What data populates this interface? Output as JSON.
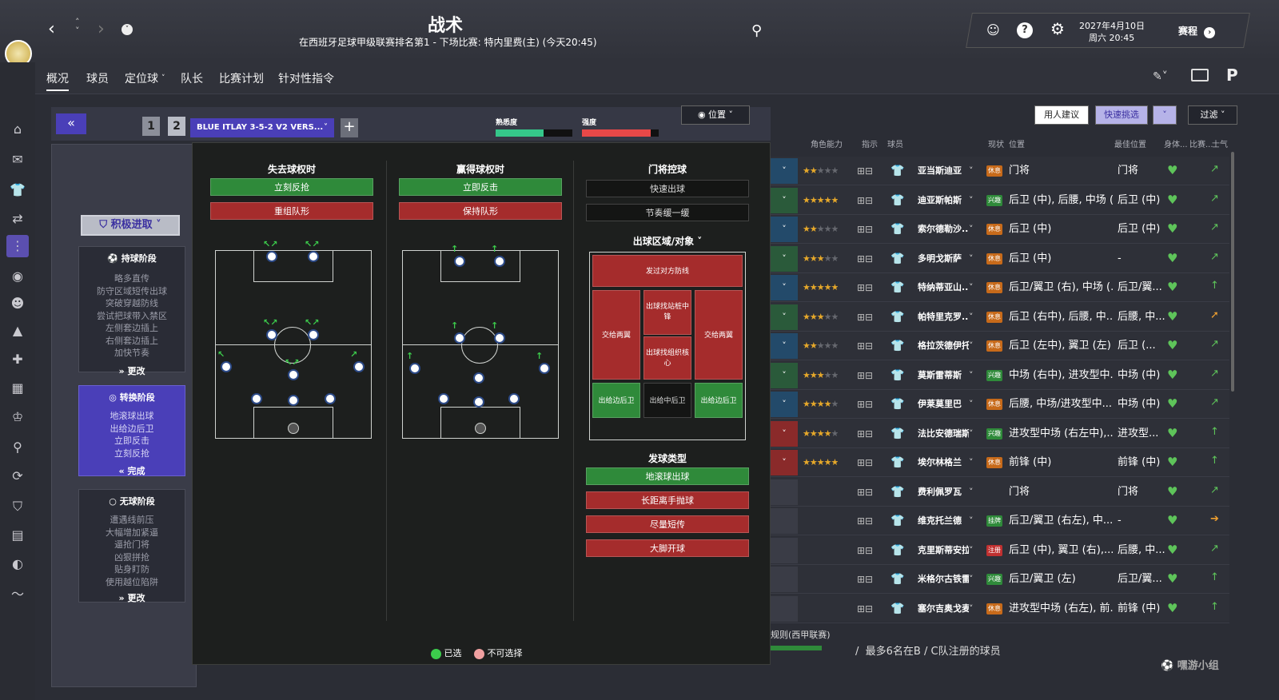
{
  "header": {
    "title": "战术",
    "subtitle": "在西班牙足球甲级联赛排名第1 - 下场比赛: 特内里费(主) (今天20:45)",
    "date": "2027年4月10日",
    "weekday_time": "周六 20:45",
    "continue": "赛程"
  },
  "nav": {
    "items": [
      "概况",
      "球员",
      "定位球",
      "队长",
      "比赛计划",
      "针对性指令"
    ]
  },
  "tactic": {
    "name": "BLUE ITLAY 3-5-2 V2 VERS...",
    "slots": [
      "1",
      "2"
    ],
    "familiarity": "熟悉度",
    "intensity": "强度",
    "familiarity_fill": 0.62,
    "intensity_fill": 0.9,
    "mentality": "积极进取"
  },
  "phases": [
    {
      "title": "持球阶段",
      "items": [
        "略多直传",
        "防守区域短传出球",
        "突破穿越防线",
        "尝试把球带入禁区",
        "左侧套边插上",
        "右侧套边插上",
        "加快节奏"
      ],
      "action": "更改"
    },
    {
      "title": "转换阶段",
      "items": [
        "地滚球出球",
        "出给边后卫",
        "立即反击",
        "立刻反抢"
      ],
      "action": "完成"
    },
    {
      "title": "无球阶段",
      "items": [
        "遭遇线前压",
        "大幅增加紧逼",
        "逼抢门将",
        "凶狠拼抢",
        "贴身盯防",
        "使用越位陷阱"
      ],
      "action": "更改"
    }
  ],
  "transition": {
    "lose_title": "失去球权时",
    "lose_opts": [
      "立刻反抢",
      "重组队形"
    ],
    "win_title": "赢得球权时",
    "win_opts": [
      "立即反击",
      "保持队形"
    ],
    "gk_title": "门将控球",
    "gk_opts": [
      "快速出球",
      "节奏缓一缓"
    ],
    "dist_title": "出球区域/对象",
    "dist_zones": [
      "发过对方防线",
      "交给两翼",
      "出球找站桩中锋",
      "交给两翼",
      "出球找组织核心",
      "出给边后卫",
      "出给中后卫",
      "出给边后卫"
    ],
    "kick_title": "发球类型",
    "kick_opts": [
      "地滚球出球",
      "长距离手抛球",
      "尽量短传",
      "大脚开球"
    ],
    "legend_selected": "已选",
    "legend_unavail": "不可选择"
  },
  "right": {
    "view_btn": "位置",
    "advice": "用人建议",
    "quickpick": "快速挑选",
    "filter": "过滤",
    "headers": [
      "角色能力",
      "指示",
      "球员",
      "现状",
      "位置",
      "最佳位置",
      "身体...",
      "比赛...",
      "士气"
    ],
    "rows": [
      {
        "name": "亚当斯迪亚",
        "status": "休息",
        "pos": "门将",
        "best": "门将",
        "stars": 2
      },
      {
        "name": "迪亚斯帕斯",
        "status": "兴趣",
        "pos": "后卫 (中), 后腰, 中场 (...",
        "best": "后卫 (中)",
        "stars": 5
      },
      {
        "name": "索尔德勒沙...",
        "status": "休息",
        "pos": "后卫 (中)",
        "best": "后卫 (中)",
        "stars": 2
      },
      {
        "name": "多明戈斯萨",
        "status": "休息",
        "pos": "后卫 (中)",
        "best": "-",
        "stars": 3
      },
      {
        "name": "特纳蒂亚山...",
        "status": "休息",
        "pos": "后卫/翼卫 (右), 中场 (...",
        "best": "后卫/翼...",
        "stars": 5
      },
      {
        "name": "帕特里克罗...",
        "status": "休息",
        "pos": "后卫 (右中), 后腰, 中...",
        "best": "后腰, 中...",
        "stars": 3
      },
      {
        "name": "格拉茨德伊托...",
        "status": "休息",
        "pos": "后卫 (左中), 翼卫 (左)",
        "best": "后卫 (...",
        "stars": 2
      },
      {
        "name": "莫斯雷蒂斯",
        "status": "兴趣",
        "pos": "中场 (右中), 进攻型中...",
        "best": "中场 (中)",
        "stars": 3
      },
      {
        "name": "伊莱莫里巴",
        "status": "休息",
        "pos": "后腰, 中场/进攻型中...",
        "best": "中场 (中)",
        "stars": 4
      },
      {
        "name": "法比安德瑞斯",
        "status": "兴趣",
        "pos": "进攻型中场 (右左中),...",
        "best": "进攻型...",
        "stars": 4
      },
      {
        "name": "埃尔林格兰",
        "status": "休息",
        "pos": "前锋 (中)",
        "best": "前锋 (中)",
        "stars": 5
      },
      {
        "name": "费利佩罗瓦",
        "status": "",
        "pos": "门将",
        "best": "门将",
        "stars": 0
      },
      {
        "name": "维克托兰德",
        "status": "挂牌",
        "pos": "后卫/翼卫 (右左), 中...",
        "best": "-",
        "stars": 0
      },
      {
        "name": "克里斯蒂安拉...",
        "status": "注册",
        "pos": "后卫 (中), 翼卫 (右),...",
        "best": "后腰, 中...",
        "stars": 0
      },
      {
        "name": "米格尔古铁雷",
        "status": "兴趣",
        "pos": "后卫/翼卫 (左)",
        "best": "后卫/翼...",
        "stars": 0
      },
      {
        "name": "塞尔吉奥戈麦",
        "status": "休息",
        "pos": "进攻型中场 (右左), 前...",
        "best": "前锋 (中)",
        "stars": 0
      }
    ],
    "footer_rule": "规则(西甲联赛)",
    "footer_note": "最多6名在B / C队注册的球员"
  },
  "colors": {
    "accent": "#4a3fb8",
    "green": "#2f8a3a",
    "red": "#a52c2c"
  }
}
